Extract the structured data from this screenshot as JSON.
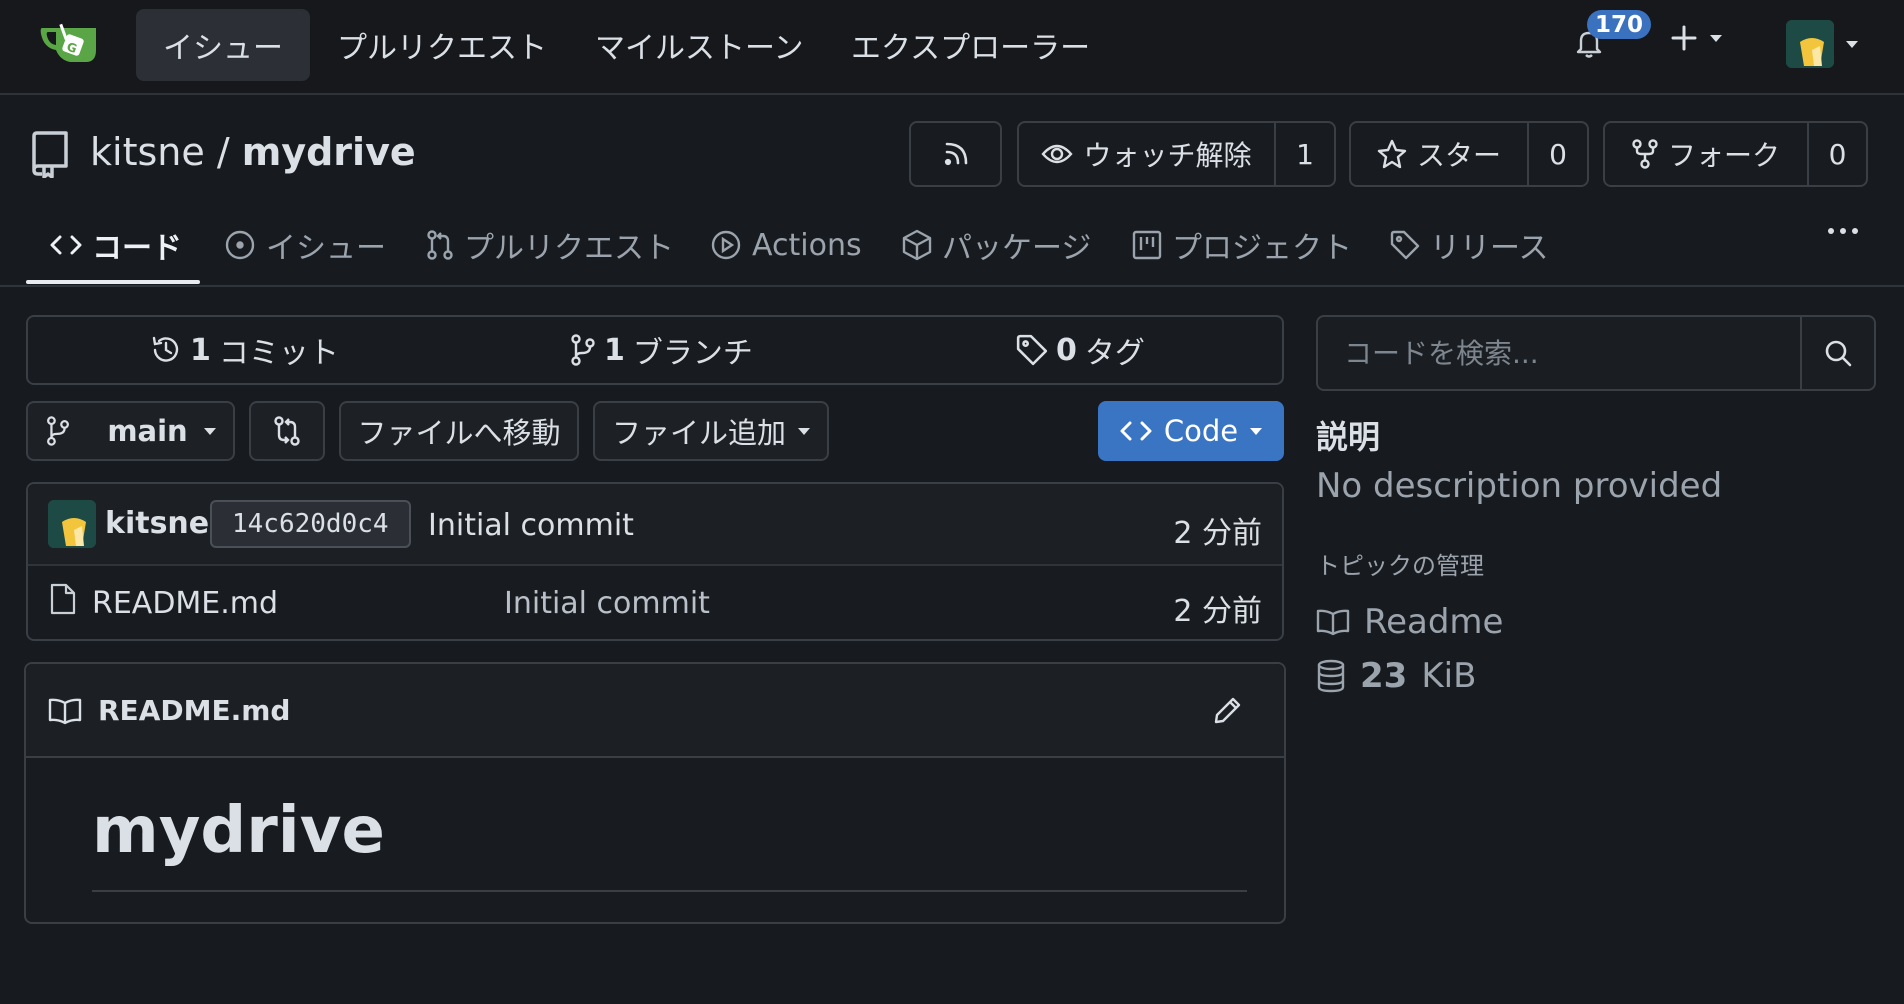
{
  "nav": {
    "items": [
      "イシュー",
      "プルリクエスト",
      "マイルストーン",
      "エクスプローラー"
    ],
    "notification_count": "170"
  },
  "repo": {
    "owner": "kitsne",
    "separator": "/",
    "name": "mydrive"
  },
  "header_buttons": {
    "unwatch_label": "ウォッチ解除",
    "watch_count": "1",
    "star_label": "スター",
    "star_count": "0",
    "fork_label": "フォーク",
    "fork_count": "0"
  },
  "tabs": [
    "コード",
    "イシュー",
    "プルリクエスト",
    "Actions",
    "パッケージ",
    "プロジェクト",
    "リリース"
  ],
  "stats": {
    "commits_count": "1",
    "commits_label": "コミット",
    "branches_count": "1",
    "branches_label": "ブランチ",
    "tags_count": "0",
    "tags_label": "タグ"
  },
  "toolbar": {
    "branch": "main",
    "goto_file": "ファイルへ移動",
    "add_file": "ファイル追加",
    "code": "Code"
  },
  "last_commit": {
    "author": "kitsne",
    "sha": "14c620d0c4",
    "message": "Initial commit",
    "time": "2 分前"
  },
  "files": [
    {
      "name": "README.md",
      "message": "Initial commit",
      "time": "2 分前"
    }
  ],
  "readme": {
    "filename": "README.md",
    "heading": "mydrive"
  },
  "sidebar": {
    "search_placeholder": "コードを検索...",
    "description_title": "説明",
    "description": "No description provided",
    "manage_topics": "トピックの管理",
    "readme_link": "Readme",
    "size_value": "23",
    "size_unit": "KiB"
  },
  "colors": {
    "accent": "#3a75c4",
    "background": "#171a1e",
    "logo_green": "#5aa646"
  }
}
